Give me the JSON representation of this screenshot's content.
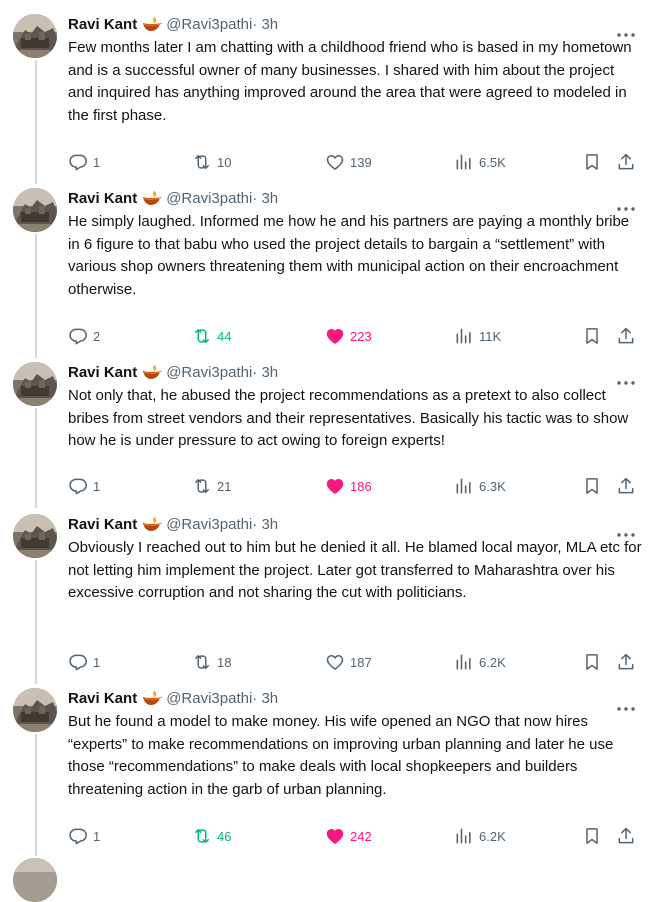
{
  "tweets": [
    {
      "author": "Ravi Kant",
      "handle": "@Ravi3pathi",
      "time": "· 3h",
      "text": "Few months later I am chatting with a childhood friend who is based in my hometown and is a successful owner of many businesses. I shared with him about the project and inquired has anything improved around the area that were agreed to modeled in the first phase.",
      "replies": "1",
      "retweets": "10",
      "likes": "139",
      "views": "6.5K",
      "retweeted": false,
      "liked": false
    },
    {
      "author": "Ravi Kant",
      "handle": "@Ravi3pathi",
      "time": "· 3h",
      "text": "He simply laughed. Informed me how he and his partners are paying a monthly bribe in 6 figure to that babu who used the project details to bargain a “settlement” with various shop owners threatening them with municipal action on their encroachment otherwise.",
      "replies": "2",
      "retweets": "44",
      "likes": "223",
      "views": "11K",
      "retweeted": true,
      "liked": true
    },
    {
      "author": "Ravi Kant",
      "handle": "@Ravi3pathi",
      "time": "· 3h",
      "text": "Not only that, he abused the project recommendations as a pretext to also collect bribes from street vendors and their representatives. Basically his tactic was to show how he is under pressure to act owing to foreign experts!",
      "replies": "1",
      "retweets": "21",
      "likes": "186",
      "views": "6.3K",
      "retweeted": false,
      "liked": true
    },
    {
      "author": "Ravi Kant",
      "handle": "@Ravi3pathi",
      "time": "· 3h",
      "text": "Obviously I reached out to him but he denied it all. He blamed local mayor, MLA etc for not letting him implement the project. Later got transferred to Maharashtra over his excessive corruption and not sharing the cut with politicians.",
      "replies": "1",
      "retweets": "18",
      "likes": "187",
      "views": "6.2K",
      "retweeted": false,
      "liked": false
    },
    {
      "author": "Ravi Kant",
      "handle": "@Ravi3pathi",
      "time": "· 3h",
      "text": "But he found a model to make money. His wife opened an NGO that now hires “experts” to make recommendations on improving urban planning and later he use those “recommendations” to make deals with local shopkeepers and builders threatening action in the garb of urban planning.",
      "replies": "1",
      "retweets": "46",
      "likes": "242",
      "views": "6.2K",
      "retweeted": true,
      "liked": true
    }
  ],
  "icons": {
    "reply": "reply-icon",
    "retweet": "retweet-icon",
    "like": "heart-icon",
    "views": "views-icon",
    "bookmark": "bookmark-icon",
    "share": "share-icon",
    "more": "more-icon",
    "emoji": "diya-lamp-emoji"
  },
  "colors": {
    "retweeted": "#00ba7c",
    "liked": "#f91880",
    "muted": "#536471",
    "thread_line": "#cfd9de"
  }
}
